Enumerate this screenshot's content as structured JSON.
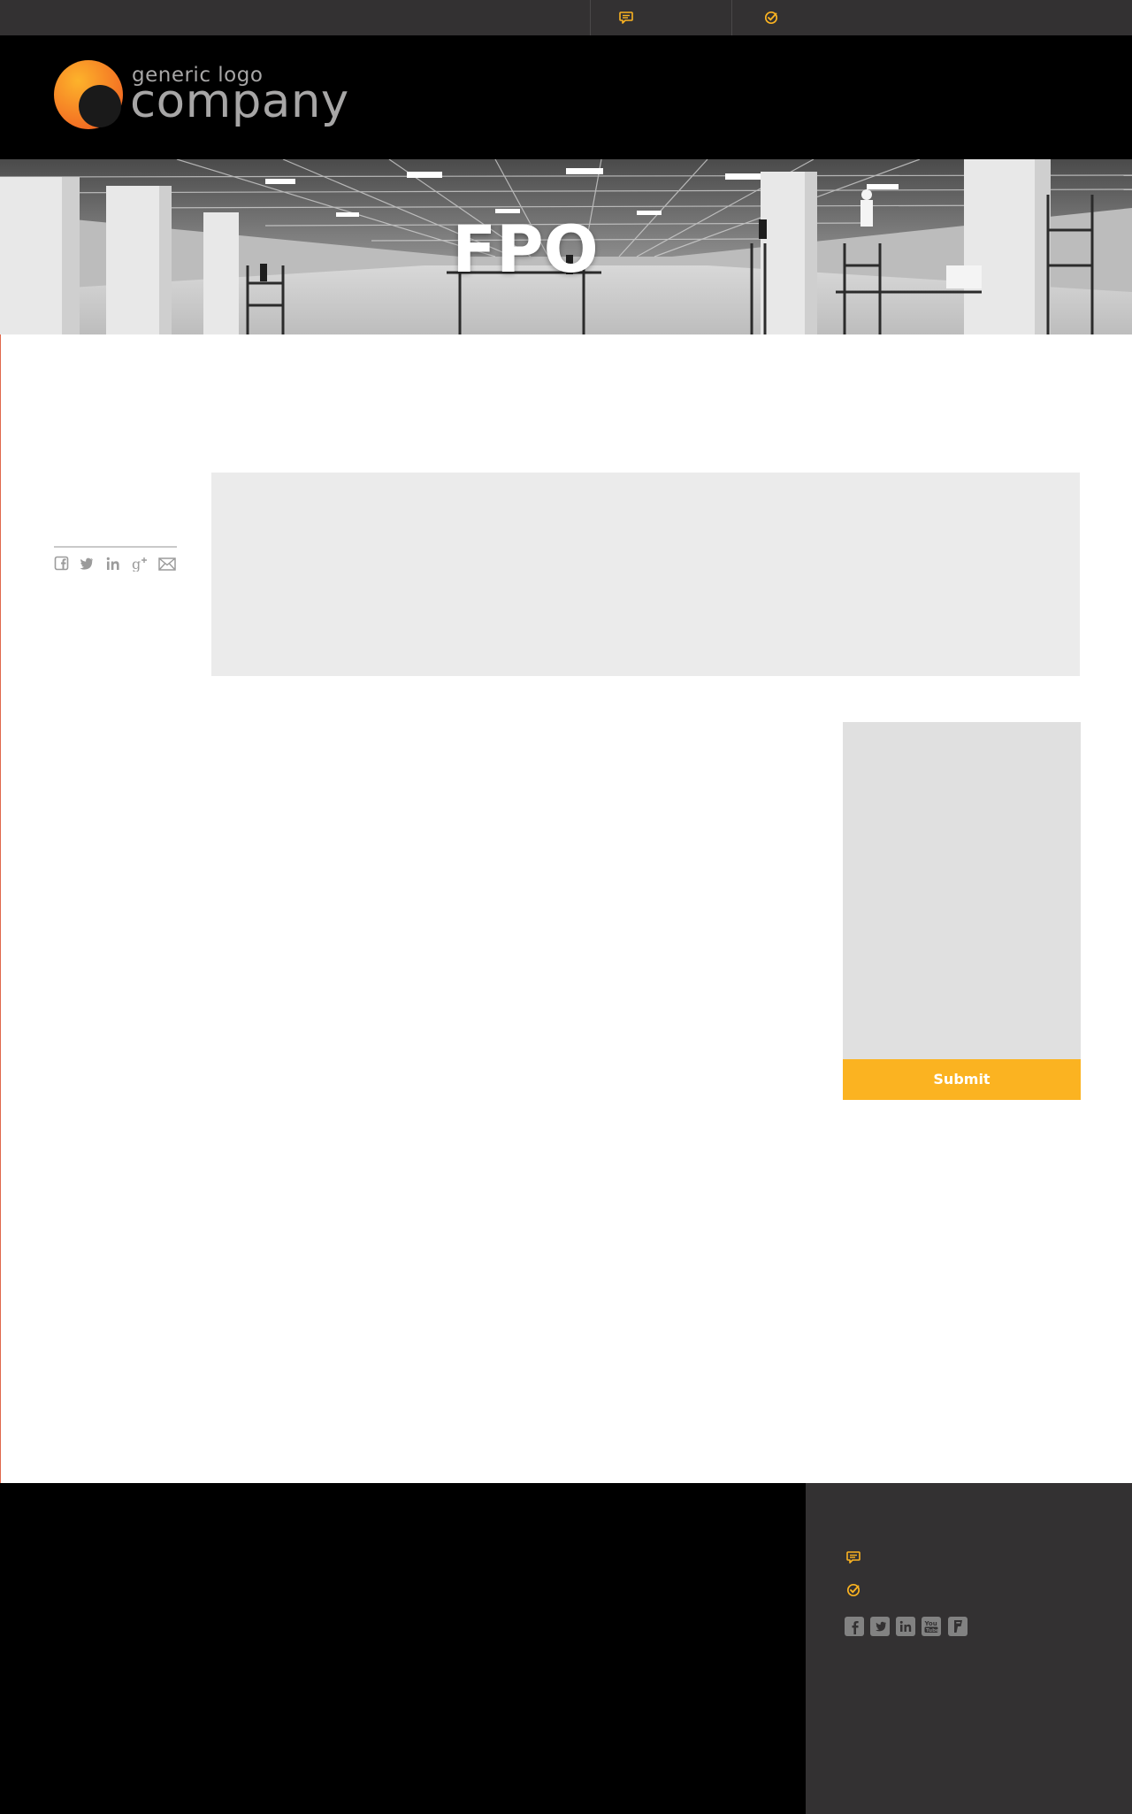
{
  "topbar": {
    "icons": [
      "chat-bubble-icon",
      "check-circle-icon"
    ]
  },
  "header": {
    "logo_tagline": "generic logo",
    "logo_name": "company"
  },
  "hero": {
    "title": "FPO"
  },
  "share": {
    "icons": [
      "facebook-icon",
      "twitter-icon",
      "linkedin-icon",
      "google-plus-icon",
      "email-icon"
    ]
  },
  "form": {
    "submit_label": "Submit"
  },
  "footer": {
    "icons": [
      "chat-bubble-icon",
      "check-circle-icon"
    ],
    "social_icons": [
      "facebook-icon",
      "twitter-icon",
      "linkedin-icon",
      "youtube-icon",
      "foursquare-icon"
    ]
  },
  "colors": {
    "accent": "#fbb321",
    "logo_orange": "#f7941e",
    "dark_bar": "#333132",
    "header_bg": "#000000",
    "placeholder_gray": "#ebebeb"
  }
}
